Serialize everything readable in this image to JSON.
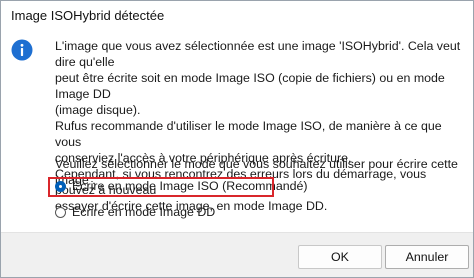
{
  "dialog": {
    "title": "Image ISOHybrid détectée",
    "icon": "info-icon",
    "message": "L'image que vous avez sélectionnée est une image 'ISOHybrid'. Cela veut dire qu'elle\npeut être écrite soit en mode Image ISO (copie de fichiers) ou en mode Image DD\n(image disque).\nRufus recommande d'utiliser le mode Image ISO, de manière à ce que vous\nconserviez l'accès à votre périphérique après écriture.\nCependant, si vous rencontrez des erreurs lors du démarrage, vous pouvez à nouveau\nessayer d'écrire cette image, en mode Image DD.",
    "prompt": "Veuillez sélectionner le mode que vous souhaitez utiliser pour écrire cette image :",
    "options": [
      {
        "label": "Ecrire en mode Image ISO (Recommandé)",
        "selected": true
      },
      {
        "label": "Ecrire en mode Image DD",
        "selected": false
      }
    ],
    "buttons": {
      "ok": "OK",
      "cancel": "Annuler"
    },
    "colors": {
      "accent": "#005fb8",
      "highlight_border": "#d9262b",
      "footer_bg": "#f0f0f0"
    }
  }
}
